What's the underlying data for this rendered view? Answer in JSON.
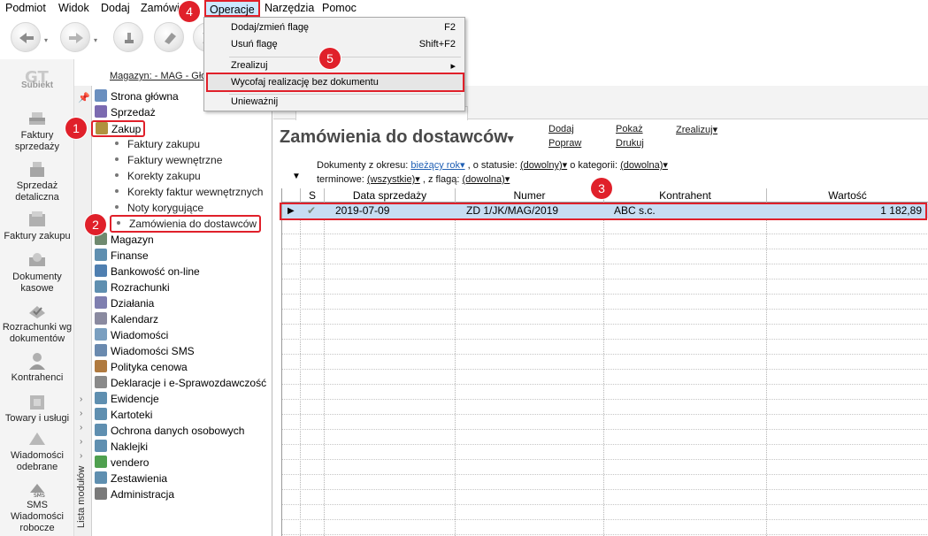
{
  "menubar": {
    "items": [
      "Podmiot",
      "Widok",
      "Dodaj",
      "Zamówienie",
      "Operacje",
      "Narzędzia",
      "Pomoc"
    ]
  },
  "dropdown": {
    "items": [
      {
        "label": "Dodaj/zmień flagę",
        "shortcut": "F2"
      },
      {
        "label": "Usuń flagę",
        "shortcut": "Shift+F2"
      },
      {
        "label": "Zrealizuj",
        "shortcut": "▸"
      },
      {
        "label": "Wycofaj realizację bez dokumentu",
        "shortcut": ""
      },
      {
        "label": "Unieważnij",
        "shortcut": ""
      }
    ]
  },
  "leftbar": {
    "logo": "Subiekt",
    "items": [
      {
        "label": "Faktury sprzedaży",
        "icon": "invoice-stack-icon"
      },
      {
        "label": "Sprzedaż detaliczna",
        "icon": "cash-register-icon"
      },
      {
        "label": "Faktury zakupu",
        "icon": "purchase-invoice-icon"
      },
      {
        "label": "Dokumenty kasowe",
        "icon": "cash-document-icon"
      },
      {
        "label": "Rozrachunki wg dokumentów",
        "icon": "settlements-icon"
      },
      {
        "label": "Kontrahenci",
        "icon": "contractor-icon"
      },
      {
        "label": "Towary i usługi",
        "icon": "goods-icon"
      },
      {
        "label": "Wiadomości odebrane",
        "icon": "message-icon"
      },
      {
        "label": "SMS Wiadomości robocze",
        "icon": "sms-icon"
      }
    ]
  },
  "magazyn_label": "Magazyn: - MAG - Głó",
  "module_panel_label": "Lista modułów",
  "tree": {
    "items": [
      {
        "label": "Strona główna",
        "color": "#6a8fbf"
      },
      {
        "label": "Sprzedaż",
        "color": "#7b6ab0"
      },
      {
        "label": "Zakup",
        "color": "#b0923f"
      },
      {
        "label": "Magazyn",
        "color": "#6f8a6f"
      },
      {
        "label": "Finanse",
        "color": "#5f8fb0"
      },
      {
        "label": "Bankowość on-line",
        "color": "#4f7fb0"
      },
      {
        "label": "Rozrachunki",
        "color": "#5f8fb0"
      },
      {
        "label": "Działania",
        "color": "#7f7fb0"
      },
      {
        "label": "Kalendarz",
        "color": "#8a8aa0"
      },
      {
        "label": "Wiadomości",
        "color": "#7a9fc0"
      },
      {
        "label": "Wiadomości SMS",
        "color": "#6a8aaf"
      },
      {
        "label": "Polityka cenowa",
        "color": "#b07a3f"
      },
      {
        "label": "Deklaracje i e-Sprawozdawczość",
        "color": "#8a8a8a"
      },
      {
        "label": "Ewidencje",
        "color": "#5f8fb0"
      },
      {
        "label": "Kartoteki",
        "color": "#5f8fb0"
      },
      {
        "label": "Ochrona danych osobowych",
        "color": "#5f8fb0"
      },
      {
        "label": "Naklejki",
        "color": "#5f8fb0"
      },
      {
        "label": "vendero",
        "color": "#4fa04f"
      },
      {
        "label": "Zestawienia",
        "color": "#5f8fb0"
      },
      {
        "label": "Administracja",
        "color": "#7a7a7a"
      }
    ],
    "sub_items": [
      "Faktury zakupu",
      "Faktury wewnętrzne",
      "Korekty zakupu",
      "Korekty faktur wewnętrznych",
      "Noty korygujące",
      "Zamówienia do dostawców"
    ]
  },
  "content": {
    "title": "Zamówienia do dostawców",
    "title_arrow": "▾",
    "actions": {
      "dodaj": "Dodaj",
      "popraw": "Popraw",
      "pokaz": "Pokaż",
      "drukuj": "Drukuj",
      "zrealizuj": "Zrealizuj▾"
    },
    "filters": {
      "period_label": "Dokumenty z okresu:",
      "period_value": "bieżący rok▾",
      "status_label": ", o statusie:",
      "status_value": "(dowolny)▾",
      "category_label": "o kategorii:",
      "category_value": "(dowolna)▾",
      "term_label": "terminowe:",
      "term_value": "(wszystkie)▾",
      "flag_label": ", z flagą:",
      "flag_value": "(dowolna)▾"
    },
    "grid": {
      "columns": [
        "S",
        "Data sprzedaży",
        "Numer",
        "Kontrahent",
        "Wartość"
      ],
      "rows": [
        {
          "pointer": "▶",
          "status": "✔",
          "date": "2019-07-09",
          "number": "ZD 1/JK/MAG/2019",
          "contractor": "ABC s.c.",
          "value": "1 182,89"
        }
      ]
    }
  },
  "badges": [
    "1",
    "2",
    "3",
    "4",
    "5"
  ],
  "colors": {
    "highlight": "#e0202a",
    "selected_row": "#c7ddf2",
    "link_blue": "#1f5fb4"
  }
}
